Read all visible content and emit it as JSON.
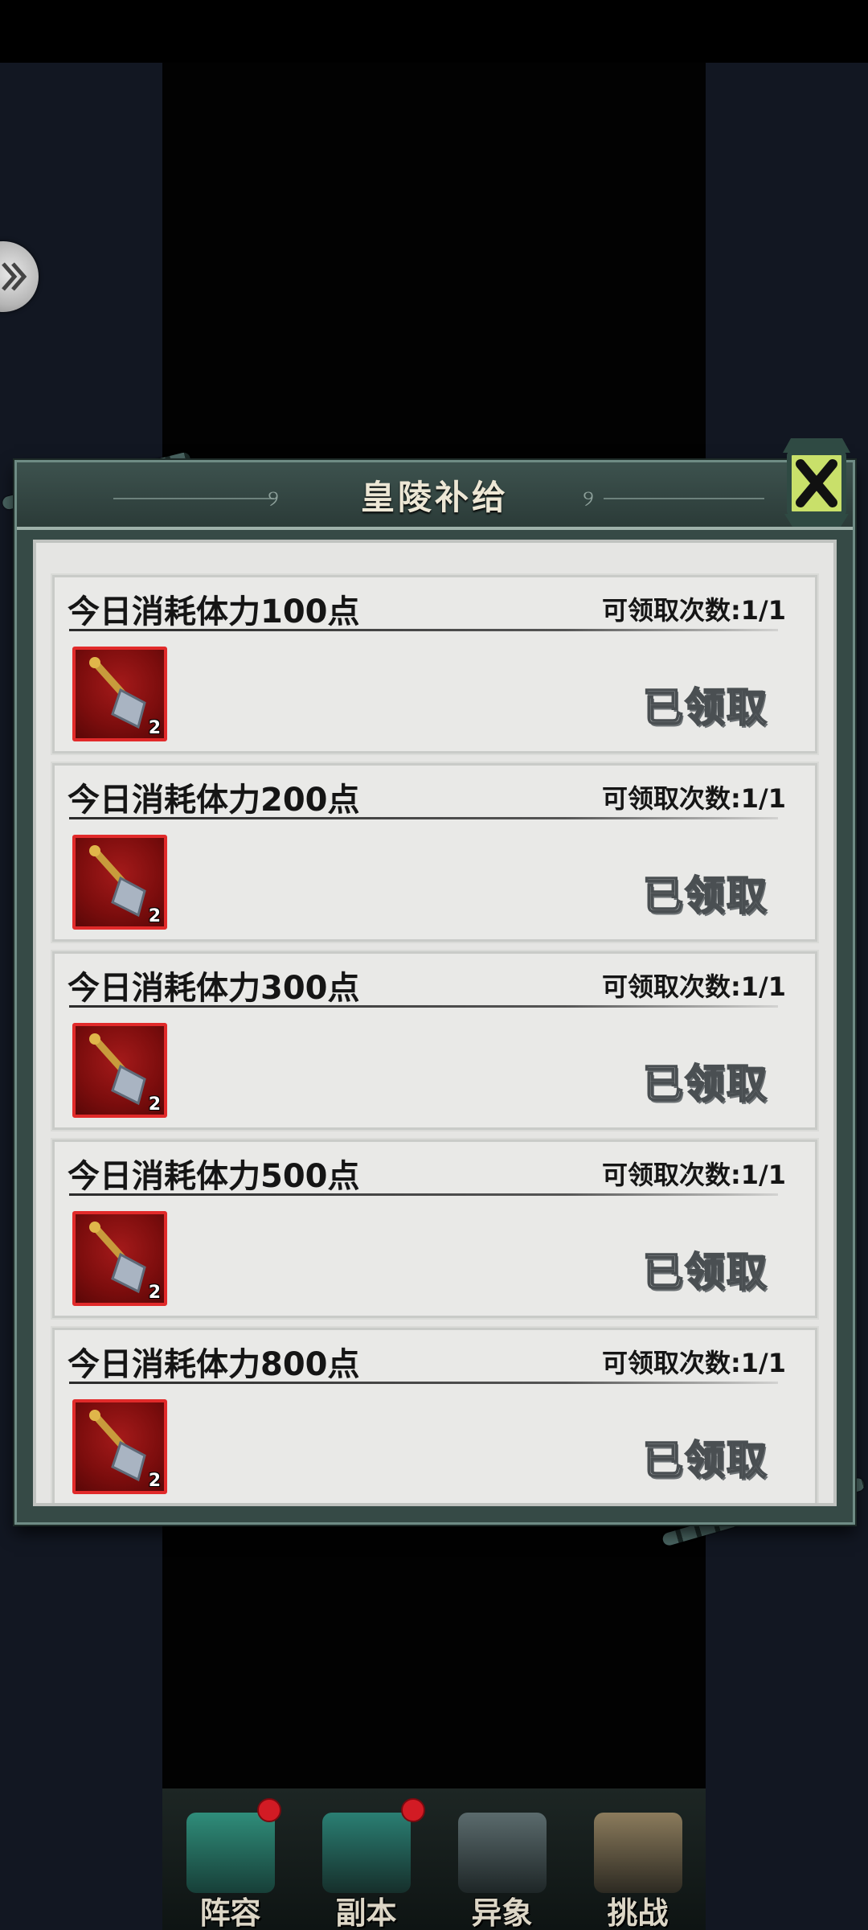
{
  "modal": {
    "title": "皇陵补给",
    "tasks": [
      {
        "title": "今日消耗体力100点",
        "count_label": "可领取次数:1/1",
        "item_qty": "2",
        "status": "已领取"
      },
      {
        "title": "今日消耗体力200点",
        "count_label": "可领取次数:1/1",
        "item_qty": "2",
        "status": "已领取"
      },
      {
        "title": "今日消耗体力300点",
        "count_label": "可领取次数:1/1",
        "item_qty": "2",
        "status": "已领取"
      },
      {
        "title": "今日消耗体力500点",
        "count_label": "可领取次数:1/1",
        "item_qty": "2",
        "status": "已领取"
      },
      {
        "title": "今日消耗体力800点",
        "count_label": "可领取次数:1/1",
        "item_qty": "2",
        "status": "已领取"
      }
    ],
    "item_icon": "shovel-icon"
  },
  "nav": {
    "items": [
      {
        "label": "阵容",
        "icon": "lineup-icon",
        "badge": true
      },
      {
        "label": "副本",
        "icon": "dungeon-sword-icon",
        "badge": true
      },
      {
        "label": "异象",
        "icon": "crossed-swords-icon",
        "badge": false
      },
      {
        "label": "挑战",
        "icon": "scroll-icon",
        "badge": false
      }
    ]
  },
  "colors": {
    "item_frame": "#e12a2a",
    "panel_bg": "#e5e5e3",
    "modal_frame": "#364a46"
  }
}
